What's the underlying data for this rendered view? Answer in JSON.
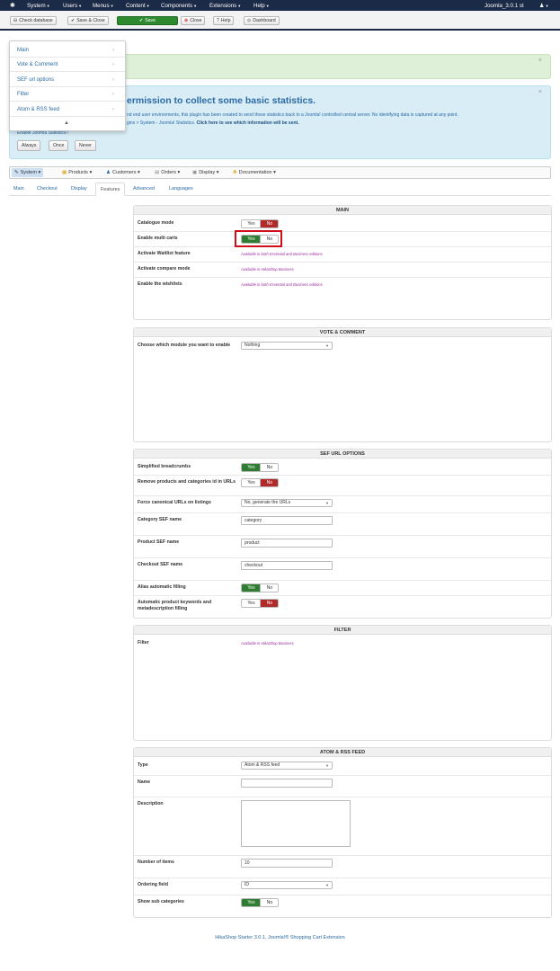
{
  "topnav": {
    "items": [
      {
        "label": "System"
      },
      {
        "label": "Users"
      },
      {
        "label": "Menus"
      },
      {
        "label": "Content"
      },
      {
        "label": "Components"
      },
      {
        "label": "Extensions"
      },
      {
        "label": "Help"
      }
    ],
    "site": "Joomla_3.0.1 st",
    "user_icon": "user-icon"
  },
  "toolbar": {
    "check_database": "Check database",
    "save_close": "Save & Close",
    "save": "Save",
    "close": "Close",
    "help": "Help",
    "dashboard": "Dashboard"
  },
  "stats": {
    "title": "ermission to collect some basic statistics.",
    "line1": "nd end user environments, this plugin has been created to send those statistics back to a Joomla! controlled central server. No identifying data is captured at any point.",
    "line2": "gins > System - Joomla! Statistics.",
    "line2_link": "Click here to see which information will be sent.",
    "line3": "Enable Joomla Statistics?",
    "always": "Always",
    "once": "Once",
    "never": "Never"
  },
  "popup": {
    "items": [
      {
        "label": "Main"
      },
      {
        "label": "Vote & Comment"
      },
      {
        "label": "SEF url options"
      },
      {
        "label": "Filter"
      },
      {
        "label": "Atom & RSS feed"
      }
    ],
    "footer_icon": "▲"
  },
  "hkmenu": {
    "system": "System",
    "products": "Products",
    "customers": "Customers",
    "orders": "Orders",
    "display": "Display",
    "documentation": "Documentation"
  },
  "tabs": [
    "Main",
    "Checkout",
    "Display",
    "Features",
    "Advanced",
    "Languages"
  ],
  "common": {
    "yes": "Yes",
    "no": "No",
    "note_essential_business": "Available in both Essential and Business editions",
    "note_business": "Available in HikaShop Business"
  },
  "main": {
    "title": "MAIN",
    "catalogue_mode": "Catalogue mode",
    "catalogue_mode_value": "No",
    "multi_carts": "Enable multi carts",
    "multi_carts_value": "Yes",
    "waitlist": "Activate Waitlist feature",
    "compare": "Activate compare mode",
    "wishlists": "Enable the wishlists"
  },
  "vote": {
    "title": "VOTE & COMMENT",
    "module_label": "Choose which module you want to enable",
    "module_value": "Nothing"
  },
  "sef": {
    "title": "SEF URL OPTIONS",
    "breadcrumbs": "Simplified breadcrumbs",
    "breadcrumbs_value": "Yes",
    "remove_id": "Remove products and categories id in URLs",
    "remove_id_value": "No",
    "canonical": "Force canonical URLs on listings",
    "canonical_value": "No, generate the URLs",
    "category_sef": "Category SEF name",
    "category_sef_value": "category",
    "product_sef": "Product SEF name",
    "product_sef_value": "product",
    "checkout_sef": "Checkout SEF name",
    "checkout_sef_value": "checkout",
    "alias_fill": "Alias automatic filling",
    "alias_fill_value": "Yes",
    "keywords": "Automatic product keywords and metadescription filling",
    "keywords_value": "No"
  },
  "filter": {
    "title": "FILTER",
    "filter_label": "Filter"
  },
  "atom": {
    "title": "ATOM & RSS FEED",
    "type": "Type",
    "type_value": "Atom & RSS feed",
    "name": "Name",
    "name_value": "",
    "description": "Description",
    "number_items": "Number of items",
    "number_items_value": "10",
    "ordering": "Ordering field",
    "ordering_value": "ID",
    "sub_categories": "Show sub categories",
    "sub_categories_value": "Yes"
  },
  "footer": "HikaShop Starter 3.0.1, Joomla!® Shopping Cart Extension",
  "colors": {
    "navbar": "#1b2a47",
    "save": "#2f8a2f",
    "yes_on": "#2f7d32",
    "no_on": "#b02a2a",
    "highlight": "#d10f1a",
    "note": "#9c2ca0"
  }
}
